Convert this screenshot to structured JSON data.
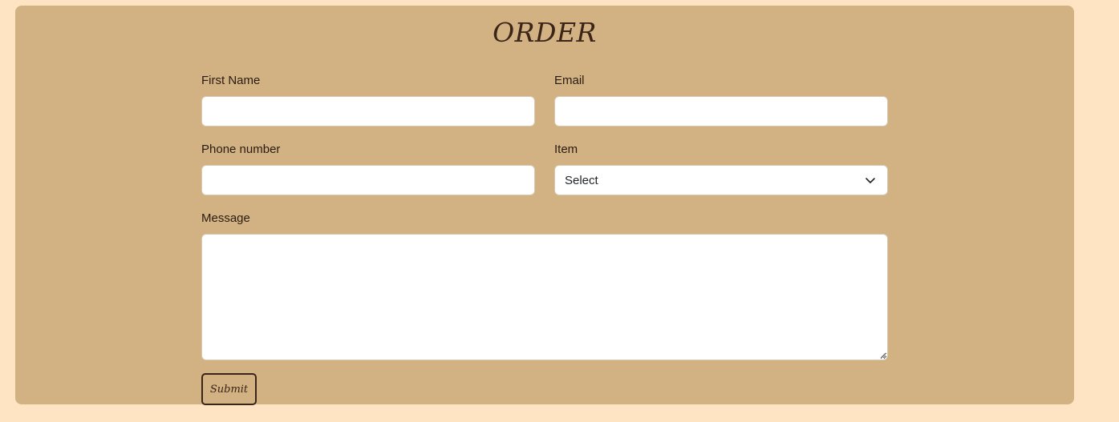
{
  "form": {
    "title": "ORDER",
    "fields": {
      "first_name": {
        "label": "First Name",
        "value": ""
      },
      "email": {
        "label": "Email",
        "value": ""
      },
      "phone": {
        "label": "Phone number",
        "value": ""
      },
      "item": {
        "label": "Item",
        "selected": "Select"
      },
      "message": {
        "label": "Message",
        "value": ""
      }
    },
    "submit_label": "Submit"
  },
  "colors": {
    "page_background": "#ffe4c4",
    "card_background": "#d2b282",
    "accent_text": "#3b2418"
  },
  "icons": {
    "select_chevron": "chevron-down-icon",
    "textarea_resize": "resize-handle-icon"
  }
}
